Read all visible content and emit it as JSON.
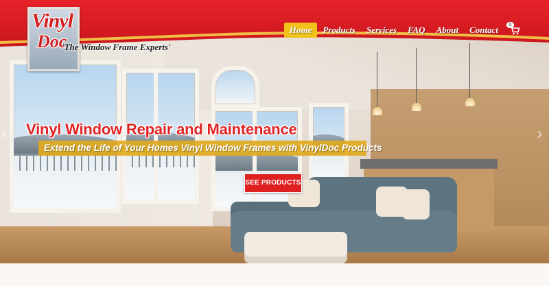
{
  "brand": {
    "logo_text_top": "Vinyl",
    "logo_text_bottom": "Doc",
    "tagline": "'The Window Frame Experts'",
    "primary_color": "#e02424",
    "accent_color": "#f0c21a"
  },
  "nav": {
    "items": [
      {
        "label": "Home",
        "active": true
      },
      {
        "label": "Products",
        "active": false
      },
      {
        "label": "Services",
        "active": false
      },
      {
        "label": "FAQ",
        "active": false
      },
      {
        "label": "About",
        "active": false
      },
      {
        "label": "Contact",
        "active": false
      }
    ],
    "cart": {
      "icon": "shopping-cart-icon",
      "count": "0"
    }
  },
  "hero": {
    "headline": "Vinyl Window Repair and Maintenance",
    "subheadline": "Extend the Life of Your Homes Vinyl Window Frames with VinylDoc Products",
    "cta_label": "SEE PRODUCTS",
    "prev_icon": "chevron-left-icon",
    "next_icon": "chevron-right-icon"
  }
}
